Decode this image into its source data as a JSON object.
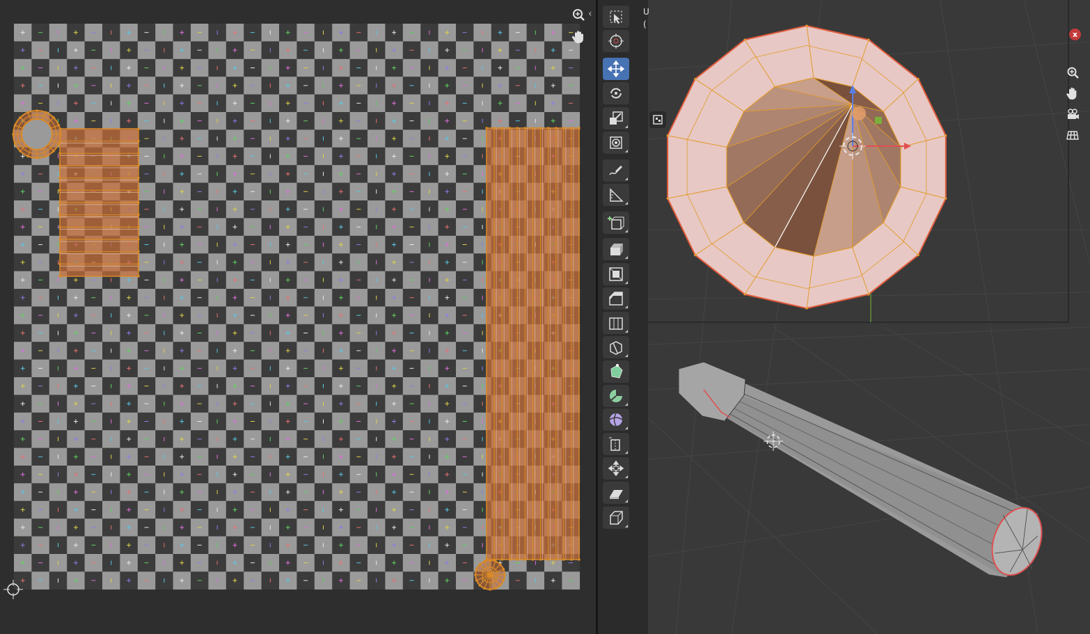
{
  "editor": {
    "uv": {
      "nav_icons": [
        "zoom-icon",
        "pan-hand-icon"
      ],
      "collapse_arrow": "‹",
      "grid": {
        "cells": 32,
        "light": "#9a9a9a",
        "dark": "#3b3b3b",
        "marker_symbols": [
          "+",
          "−",
          "|"
        ],
        "marker_colors": [
          "#e8e8e8",
          "#e87070",
          "#e0d24a",
          "#5fd35f",
          "#58c8e8",
          "#8c7ce8",
          "#e070e0"
        ]
      },
      "selection_color": "#d98a27",
      "fill_color": "#c76e38"
    },
    "toolbar": {
      "tools": [
        {
          "name": "select-box",
          "active": false
        },
        {
          "name": "cursor",
          "active": false
        },
        {
          "name": "move",
          "active": true
        },
        {
          "name": "rotate",
          "active": false
        },
        {
          "name": "scale",
          "active": false
        },
        {
          "name": "transform",
          "active": false
        },
        {
          "name": "annotate",
          "active": false
        },
        {
          "name": "measure",
          "active": false
        },
        {
          "name": "add-cube",
          "active": false
        },
        {
          "name": "extrude-region",
          "active": false
        },
        {
          "name": "inset-faces",
          "active": false
        },
        {
          "name": "bevel",
          "active": false
        },
        {
          "name": "loop-cut",
          "active": false
        },
        {
          "name": "knife",
          "active": false
        },
        {
          "name": "poly-build",
          "active": false
        },
        {
          "name": "spin",
          "active": false
        },
        {
          "name": "smooth",
          "active": false
        },
        {
          "name": "edge-slide",
          "active": false
        },
        {
          "name": "shrink-fatten",
          "active": false
        },
        {
          "name": "shear",
          "active": false
        },
        {
          "name": "rip-region",
          "active": false
        }
      ]
    },
    "viewport": {
      "header_lines": [
        "U",
        "("
      ],
      "close_label": "x",
      "side_tab_icon": "toolbox-icon",
      "nav_icons": [
        "zoom-icon",
        "pan-hand-icon",
        "camera-icon",
        "grid-view-icon"
      ],
      "axis_colors": {
        "x": "#e05050",
        "y": "#79b83a",
        "z": "#5a7ee8"
      },
      "mesh_color": "#e7c8c4",
      "selected_edge_color": "#e39a2b"
    }
  }
}
